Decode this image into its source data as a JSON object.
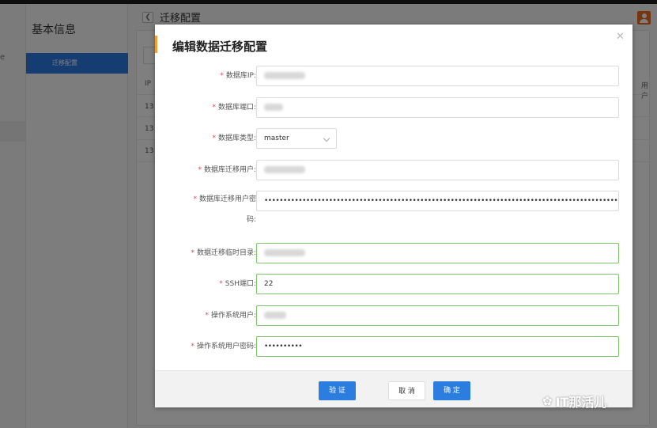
{
  "app": {
    "sidebar_title": "基本信息",
    "sidebar_active": "迁移配置",
    "breadcrumb": "迁移配置",
    "back_icon": "chevron-left-icon",
    "table_header_left": "IP",
    "table_header_right": "用户",
    "table_rows": [
      "13",
      "13",
      "13"
    ],
    "left_nav_mark": "e",
    "accent_color": "#2c7be5"
  },
  "modal": {
    "title": "编辑数据迁移配置",
    "close_icon": "close-icon",
    "fields": [
      {
        "label": "数据库IP:",
        "value": "",
        "type": "text",
        "required": true
      },
      {
        "label": "数据库端口:",
        "value": "",
        "type": "text",
        "required": true
      },
      {
        "label": "数据库类型:",
        "value": "master",
        "type": "select",
        "required": true
      },
      {
        "label": "数据库迁移用户:",
        "value": "",
        "type": "text",
        "required": true
      },
      {
        "label_line1": "数据库迁移用户密",
        "label_line2": "码:",
        "value": "••••••••••••••••••••••••••••••••••••••••••••••••••••••••••••••••••••••••••••••••••••••••••••••••",
        "type": "password",
        "required": true
      },
      {
        "label": "数据迁移临时目录:",
        "value": "",
        "type": "text",
        "required": true
      },
      {
        "label": "SSH端口:",
        "value": "22",
        "type": "text",
        "required": true
      },
      {
        "label": "操作系统用户:",
        "value": "",
        "type": "text",
        "required": true
      },
      {
        "label": "操作系统用户密码:",
        "value": "••••••••••",
        "type": "password",
        "required": true
      }
    ],
    "required_mark": "*",
    "buttons": {
      "verify": "验 证",
      "cancel": "取 消",
      "confirm": "确 定"
    }
  },
  "watermark": {
    "text": "IT那活儿",
    "icon": "wechat-icon"
  },
  "colors": {
    "primary": "#2b7de0",
    "valid_border": "#7cc36b",
    "required": "#e24b4b",
    "title_accent": "#f0a030"
  }
}
